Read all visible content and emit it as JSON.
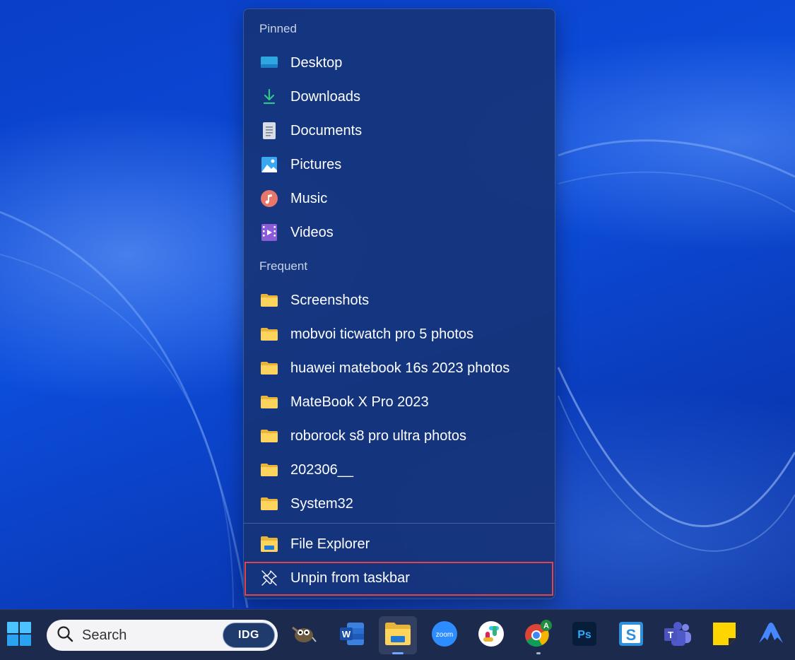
{
  "jumplist": {
    "pinned_header": "Pinned",
    "pinned": [
      {
        "label": "Desktop",
        "icon": "desktop-icon"
      },
      {
        "label": "Downloads",
        "icon": "download-arrow-icon"
      },
      {
        "label": "Documents",
        "icon": "document-icon"
      },
      {
        "label": "Pictures",
        "icon": "pictures-icon"
      },
      {
        "label": "Music",
        "icon": "music-icon"
      },
      {
        "label": "Videos",
        "icon": "video-icon"
      }
    ],
    "frequent_header": "Frequent",
    "frequent": [
      {
        "label": "Screenshots",
        "icon": "folder-icon"
      },
      {
        "label": "mobvoi ticwatch pro 5 photos",
        "icon": "folder-icon"
      },
      {
        "label": "huawei matebook 16s 2023 photos",
        "icon": "folder-icon"
      },
      {
        "label": "MateBook X Pro 2023",
        "icon": "folder-icon"
      },
      {
        "label": "roborock s8 pro ultra photos",
        "icon": "folder-icon"
      },
      {
        "label": "202306__",
        "icon": "folder-icon"
      },
      {
        "label": "System32",
        "icon": "folder-icon"
      }
    ],
    "actions": [
      {
        "label": "File Explorer",
        "icon": "file-explorer-icon"
      },
      {
        "label": "Unpin from taskbar",
        "icon": "unpin-icon"
      }
    ],
    "highlight_color": "#e0454b"
  },
  "taskbar": {
    "search_placeholder": "Search",
    "search_badge": "IDG",
    "apps": [
      {
        "name": "start-icon"
      },
      {
        "name": "gimp-icon"
      },
      {
        "name": "word-icon",
        "label": "W"
      },
      {
        "name": "file-explorer-icon"
      },
      {
        "name": "zoom-icon",
        "label": "zoom"
      },
      {
        "name": "slack-icon"
      },
      {
        "name": "chrome-icon",
        "badge": "A"
      },
      {
        "name": "photoshop-icon",
        "label": "Ps"
      },
      {
        "name": "snagit-icon",
        "label": "S"
      },
      {
        "name": "teams-icon",
        "label": "T"
      },
      {
        "name": "sticky-notes-icon"
      },
      {
        "name": "nordvpn-icon"
      }
    ]
  }
}
